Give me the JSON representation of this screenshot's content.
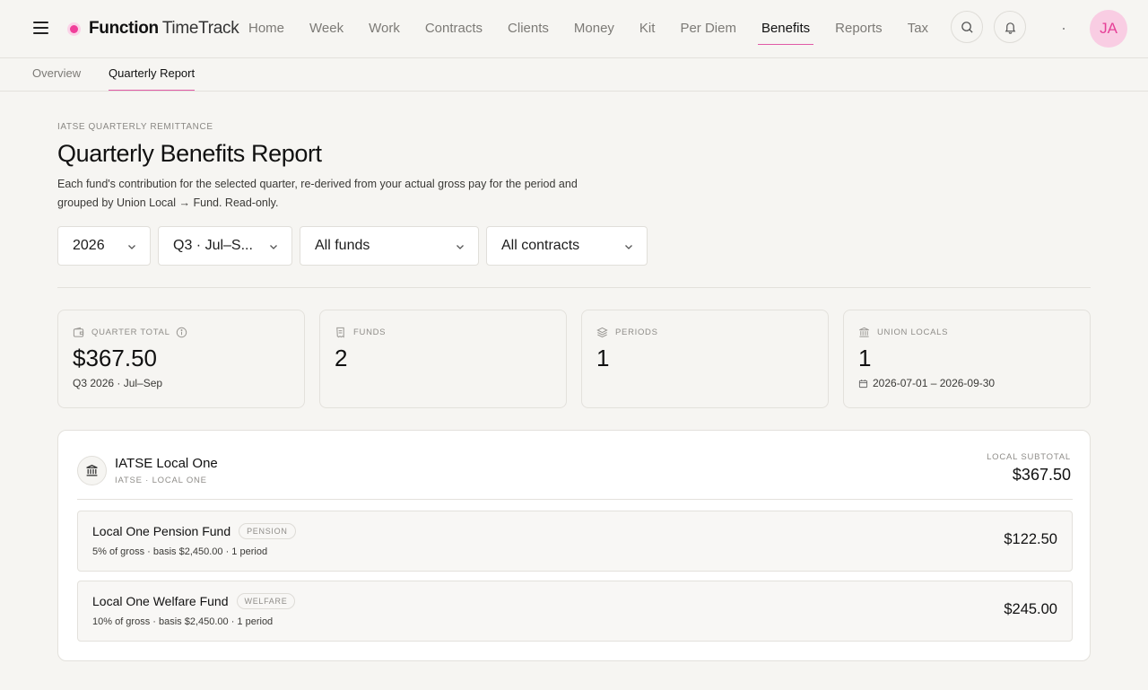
{
  "brand": {
    "name_strong": "Function",
    "name_light": "TimeTrack"
  },
  "nav": {
    "items": [
      {
        "label": "Home"
      },
      {
        "label": "Week"
      },
      {
        "label": "Work"
      },
      {
        "label": "Contracts"
      },
      {
        "label": "Clients"
      },
      {
        "label": "Money"
      },
      {
        "label": "Kit"
      },
      {
        "label": "Per Diem"
      },
      {
        "label": "Benefits",
        "active": true
      },
      {
        "label": "Reports"
      },
      {
        "label": "Tax"
      }
    ]
  },
  "user": {
    "initials": "JA"
  },
  "subtabs": [
    {
      "label": "Overview"
    },
    {
      "label": "Quarterly Report",
      "active": true
    }
  ],
  "header": {
    "eyebrow": "IATSE QUARTERLY REMITTANCE",
    "title": "Quarterly Benefits Report",
    "description": "Each fund's contribution for the selected quarter, re-derived from your actual gross pay for the period and grouped by Union Local → Fund. Read-only."
  },
  "filters": {
    "year": "2026",
    "quarter": "Q3 · Jul–S...",
    "funds": "All funds",
    "contracts": "All contracts"
  },
  "stats": {
    "quarter_total": {
      "label": "QUARTER TOTAL",
      "value": "$367.50",
      "sub": "Q3 2026 · Jul–Sep"
    },
    "funds": {
      "label": "FUNDS",
      "value": "2"
    },
    "periods": {
      "label": "PERIODS",
      "value": "1"
    },
    "union_locals": {
      "label": "UNION LOCALS",
      "value": "1",
      "sub": "2026-07-01 – 2026-09-30"
    }
  },
  "local": {
    "name": "IATSE Local One",
    "sub": "IATSE · LOCAL ONE",
    "subtotal_label": "LOCAL SUBTOTAL",
    "subtotal": "$367.50",
    "funds": [
      {
        "name": "Local One Pension Fund",
        "tag": "PENSION",
        "detail": "5% of gross · basis $2,450.00 · 1 period",
        "amount": "$122.50"
      },
      {
        "name": "Local One Welfare Fund",
        "tag": "WELFARE",
        "detail": "10% of gross · basis $2,450.00 · 1 period",
        "amount": "$245.00"
      }
    ]
  },
  "colors": {
    "accent": "#e05aa6",
    "background": "#f6f5f2"
  }
}
